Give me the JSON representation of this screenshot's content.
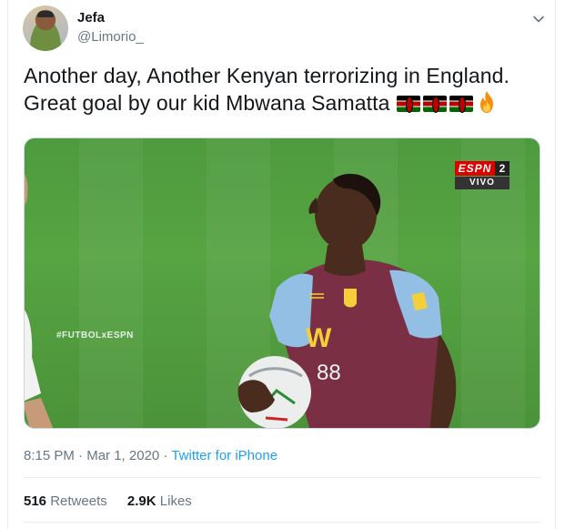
{
  "user": {
    "name": "Jefa",
    "handle": "@Limorio_"
  },
  "tweet": {
    "line1": "Another day, Another Kenyan terrorizing in England.",
    "line2": "Great goal by our kid Mbwana Samatta",
    "emojis": [
      "kenya-flag",
      "kenya-flag",
      "kenya-flag",
      "fire"
    ]
  },
  "media": {
    "network_logo": "ESPN",
    "channel_number": "2",
    "live_label": "VIVO",
    "hashtag": "#FUTBOLxESPN",
    "jersey_sponsor": "W",
    "jersey_number": "88"
  },
  "meta": {
    "time": "8:15 PM",
    "separator": " · ",
    "date": "Mar 1, 2020",
    "source": "Twitter for iPhone"
  },
  "stats": {
    "retweets_count": "516",
    "retweets_label": "Retweets",
    "likes_count": "2.9K",
    "likes_label": "Likes"
  },
  "colors": {
    "text": "#14171a",
    "secondary": "#657786",
    "link": "#1da1f2",
    "border": "#e6ecf0",
    "pitch": "#57a443",
    "jersey_claret": "#7a2f45",
    "jersey_blue": "#94bfe4"
  }
}
